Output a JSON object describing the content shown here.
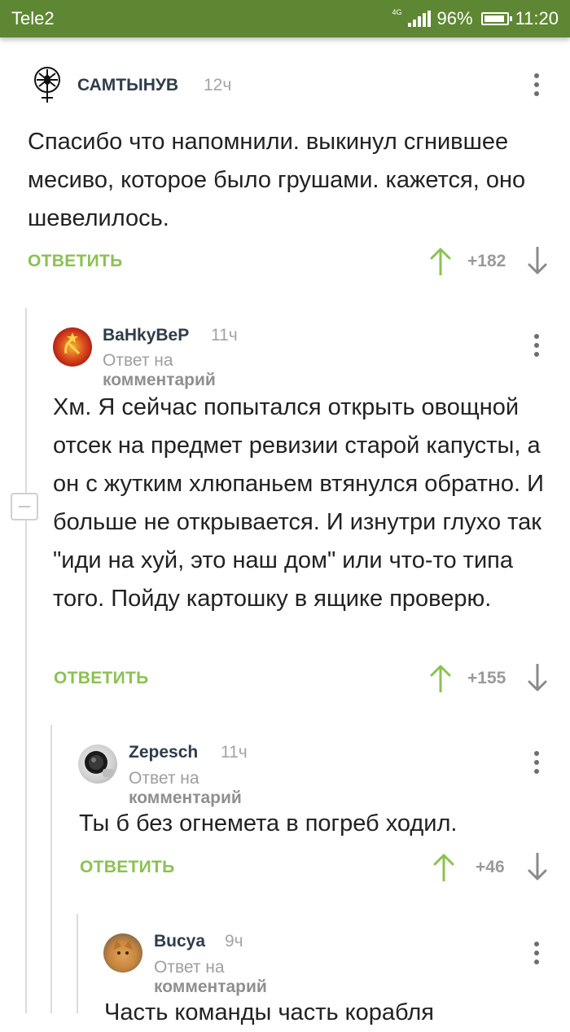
{
  "statusbar": {
    "carrier": "Tele2",
    "network": "4G",
    "battery": "96%",
    "time": "11:20"
  },
  "comments": [
    {
      "author": "САМТЫНУВ",
      "time": "12ч",
      "reply_to": "",
      "text": "Спасибо что напомнили. выкинул сгнившее месиво, которое было грушами. кажется, оно шевелилось.",
      "reply_label": "ОТВЕТИТЬ",
      "score": "+182"
    },
    {
      "author": "BaHkyBeP",
      "time": "11ч",
      "reply_to_prefix": "Ответ на",
      "reply_to_target": "комментарий",
      "text": "Хм. Я сейчас попытался открыть овощной отсек на предмет ревизии старой капусты, а он с жутким хлюпаньем втянулся обратно. И больше не открывается. И изнутри глухо так \"иди на хуй, это наш дом\" или что-то типа того. Пойду картошку в ящике проверю.",
      "reply_label": "ОТВЕТИТЬ",
      "score": "+155"
    },
    {
      "author": "Zepesch",
      "time": "11ч",
      "reply_to_prefix": "Ответ на",
      "reply_to_target": "комментарий",
      "text": "Ты б без огнемета в погреб ходил.",
      "reply_label": "ОТВЕТИТЬ",
      "score": "+46"
    },
    {
      "author": "Bucya",
      "time": "9ч",
      "reply_to_prefix": "Ответ на",
      "reply_to_target": "комментарий",
      "text": "Часть команды часть корабля"
    }
  ],
  "colors": {
    "statusbar": "#5e8733",
    "accent_green": "#8cc152"
  }
}
